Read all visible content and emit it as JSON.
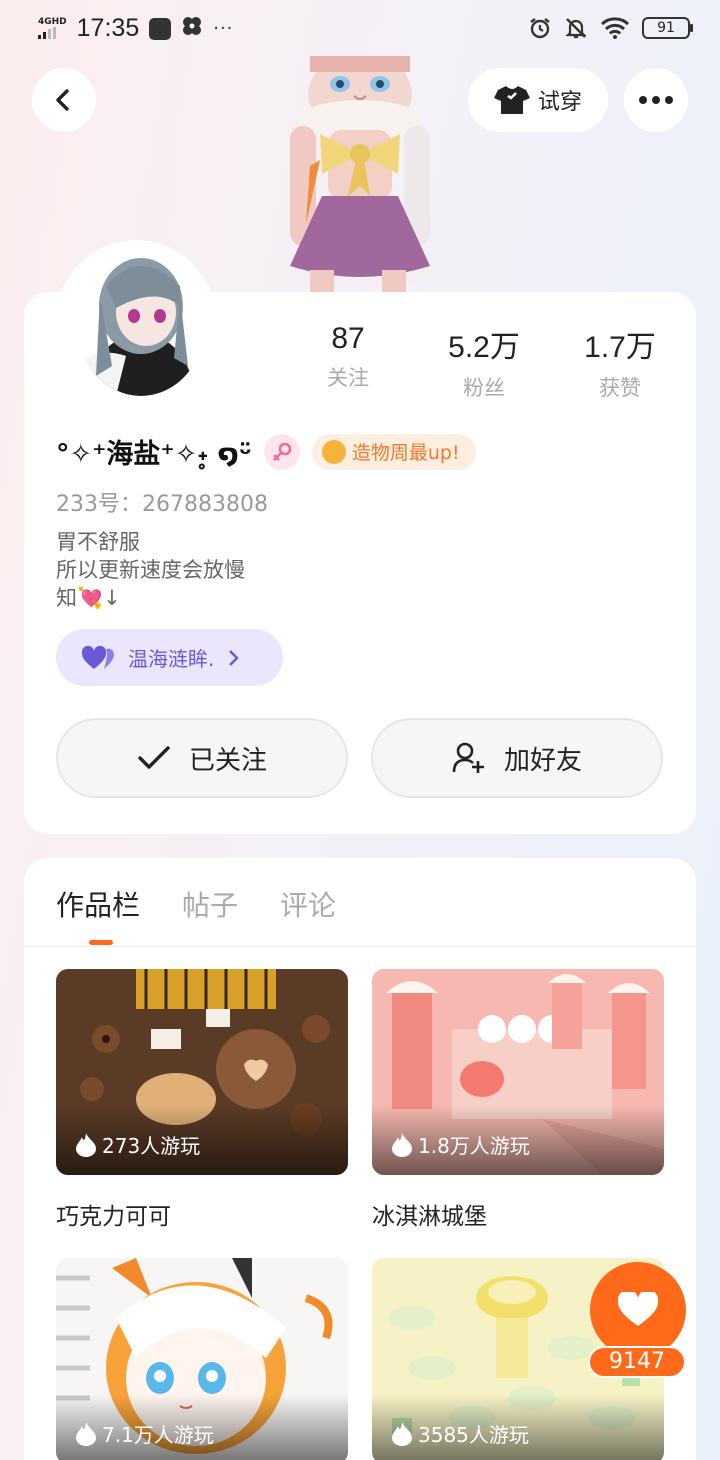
{
  "status_bar": {
    "network": "4GHD",
    "time": "17:35",
    "more": "···",
    "battery": "91"
  },
  "header": {
    "back_icon": "chevron-left-icon",
    "tryon_label": "试穿",
    "tryon_icon": "shirt-icon",
    "more_icon": "more-dots-icon"
  },
  "profile": {
    "stats": [
      {
        "value": "87",
        "label": "关注"
      },
      {
        "value": "5.2万",
        "label": "粉丝"
      },
      {
        "value": "1.7万",
        "label": "获赞"
      }
    ],
    "nickname": "°✧⁺海盐⁺✧˖̥ ໑ᵕ̈",
    "gender_icon": "female-icon",
    "honor_badge": "造物周最up!",
    "uid": "233号：267883808",
    "bio_lines": [
      "胃不舒服",
      "所以更新速度会放慢",
      "知💘↓"
    ],
    "guild": {
      "name": "温海涟眸.",
      "icon": "double-heart-icon"
    },
    "follow_label": "已关注",
    "friend_label": "加好友"
  },
  "tabs": [
    "作品栏",
    "帖子",
    "评论"
  ],
  "active_tab": "作品栏",
  "works": [
    {
      "title": "巧克力可可",
      "plays": "273人游玩"
    },
    {
      "title": "冰淇淋城堡",
      "plays": "1.8万人游玩"
    },
    {
      "title": "",
      "plays": "7.1万人游玩"
    },
    {
      "title": "",
      "plays": "3585人游玩"
    }
  ],
  "like": {
    "count": "9147",
    "icon": "heart-icon"
  },
  "colors": {
    "accent": "#ff6a1a",
    "guild_text": "#6b58d6",
    "honor_text": "#f07a2a"
  }
}
